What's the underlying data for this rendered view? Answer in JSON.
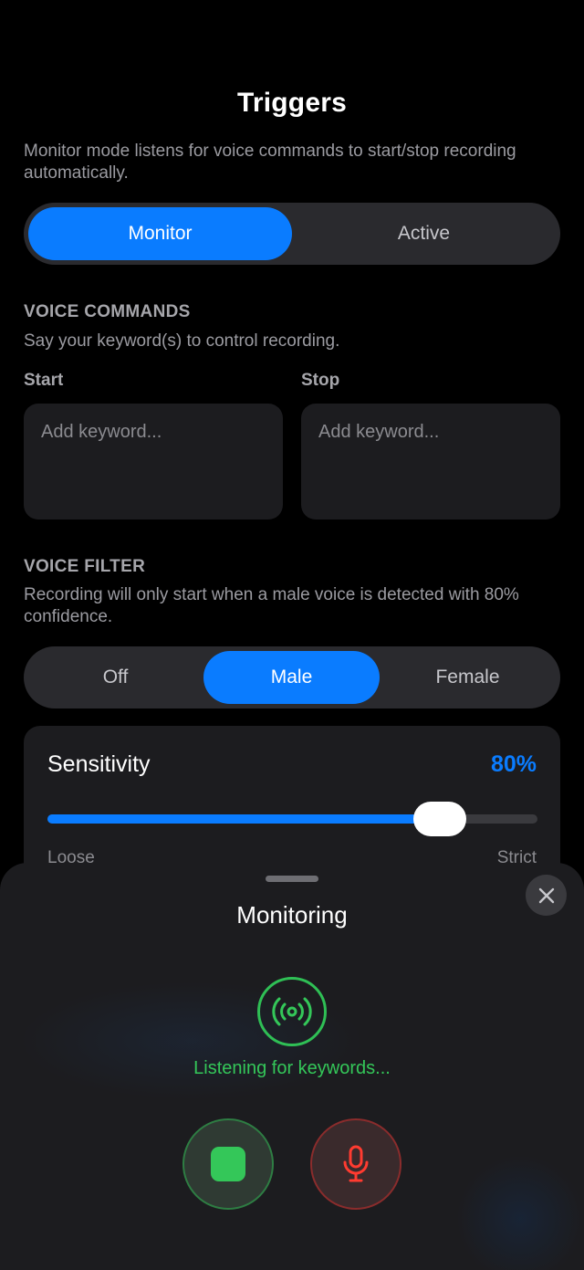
{
  "header": {
    "title": "Triggers",
    "intro": "Monitor mode listens for voice commands to start/stop recording automatically."
  },
  "mode_selector": {
    "options": [
      "Monitor",
      "Active"
    ],
    "selected": "Monitor"
  },
  "voice_commands": {
    "heading": "VOICE COMMANDS",
    "subtitle": "Say your keyword(s) to control recording.",
    "start_label": "Start",
    "stop_label": "Stop",
    "start_placeholder": "Add keyword...",
    "stop_placeholder": "Add keyword..."
  },
  "voice_filter": {
    "heading": "VOICE FILTER",
    "subtitle": "Recording will only start when a male voice is detected with 80% confidence.",
    "options": [
      "Off",
      "Male",
      "Female"
    ],
    "selected": "Male"
  },
  "sensitivity": {
    "label": "Sensitivity",
    "value_text": "80%",
    "level_fraction": 0.8,
    "min_label": "Loose",
    "max_label": "Strict"
  },
  "monitor_sheet": {
    "title": "Monitoring",
    "status": "Listening for keywords...",
    "icons": {
      "close": "close-icon",
      "broadcast": "broadcast-icon",
      "stop": "stop-icon",
      "mic": "microphone-icon"
    },
    "colors": {
      "accent_green": "#34c759",
      "accent_red": "#ff3b30",
      "accent_blue": "#0a7cff"
    }
  }
}
